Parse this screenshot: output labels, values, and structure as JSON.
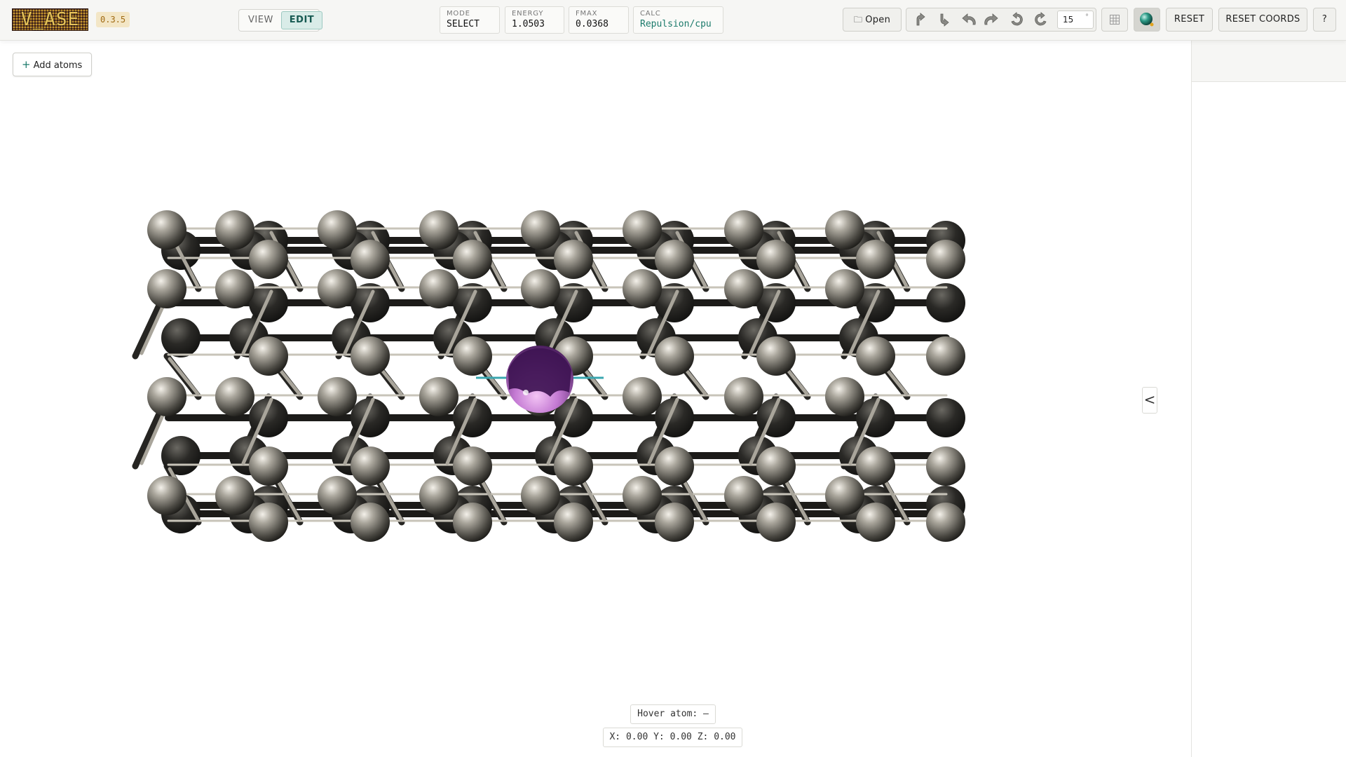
{
  "app": {
    "logo_text": "V_ASE",
    "version": "0.3.5"
  },
  "mode_switch": {
    "options": [
      "VIEW",
      "EDIT"
    ],
    "selected": "EDIT"
  },
  "stats": {
    "mode": {
      "label": "MODE",
      "value": "SELECT"
    },
    "energy": {
      "label": "ENERGY",
      "value": "1.0503"
    },
    "fmax": {
      "label": "FMAX",
      "value": "0.0368"
    },
    "calc": {
      "label": "CALC",
      "value": "Repulsion/cpu"
    }
  },
  "toolbar": {
    "open_label": "Open",
    "rotation_tools": [
      "rotate-up-icon",
      "rotate-down-icon",
      "rotate-left-icon",
      "rotate-right-icon",
      "rotate-ccw-icon",
      "rotate-cw-icon"
    ],
    "angle_value": "15",
    "angle_unit": "°",
    "reset_label": "RESET",
    "reset_coords_label": "RESET COORDS",
    "help_label": "?"
  },
  "canvas": {
    "add_atoms_label": "Add atoms",
    "collapse_label": "<",
    "hover_text": "Hover atom: –",
    "coords_text": "X: 0.00 Y: 0.00 Z: 0.00"
  },
  "colors": {
    "accent": "#1b7a6b",
    "carbon": "#5a5852",
    "dopant": "#9c4fb8"
  }
}
